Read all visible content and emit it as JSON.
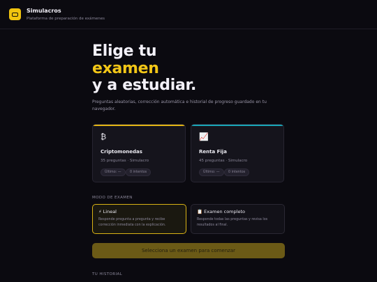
{
  "header": {
    "title": "Simulacros",
    "subtitle": "Plataforma de preparación de exámenes"
  },
  "hero": {
    "line1": "Elige tu",
    "line2": "examen",
    "line3": "y a estudiar.",
    "description": "Preguntas aleatorias, corrección automática e historial de progreso guardado en tu navegador."
  },
  "exams": [
    {
      "icon": "₿",
      "icon_name": "bitcoin-icon",
      "name": "Criptomonedas",
      "meta": "35 preguntas · Simulacro",
      "last_label": "Último: —",
      "attempts_label": "0 intentos",
      "accent": "#e3b514"
    },
    {
      "icon": "📈",
      "icon_name": "chart-up-icon",
      "name": "Renta Fija",
      "meta": "45 preguntas · Simulacro",
      "last_label": "Último: —",
      "attempts_label": "0 intentos",
      "accent": "#1aa6b8"
    }
  ],
  "mode_section": {
    "label": "MODO DE EXAMEN",
    "modes": [
      {
        "icon": "⚡",
        "title": "Lineal",
        "description": "Responde pregunta a pregunta y recibe corrección inmediata con la explicación.",
        "active": true
      },
      {
        "icon": "📋",
        "title": "Examen completo",
        "description": "Responde todas las preguntas y revisa los resultados al final.",
        "active": false
      }
    ]
  },
  "start_button": {
    "label": "Selecciona un examen para comenzar"
  },
  "history": {
    "label": "TU HISTORIAL"
  },
  "colors": {
    "background": "#0b0a10",
    "accent_yellow": "#f2c617",
    "accent_teal": "#1aa6b8"
  }
}
